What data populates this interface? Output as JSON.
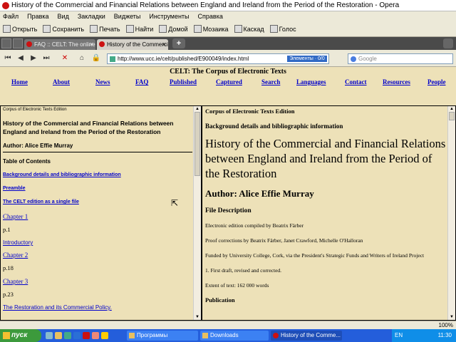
{
  "window": {
    "title": "History of the Commercial and Financial Relations between England and Ireland from the Period of the Restoration - Opera"
  },
  "menu": [
    "Файл",
    "Правка",
    "Вид",
    "Закладки",
    "Виджеты",
    "Инструменты",
    "Справка"
  ],
  "toolbar": [
    "Открыть",
    "Сохранить",
    "Печать",
    "Найти",
    "Домой",
    "Мозаика",
    "Каскад",
    "Голос"
  ],
  "tabs": [
    {
      "label": "FAQ :: CELT: The online..."
    },
    {
      "label": "History of the Commerci..."
    }
  ],
  "address": {
    "url": "http://www.ucc.ie/celt/published/E900049/index.html",
    "highlight": "Элементы · 0/0"
  },
  "search": {
    "placeholder": "Google"
  },
  "site": {
    "header": "CELT: The Corpus of Electronic Texts",
    "nav": [
      "Home",
      "About",
      "News",
      "FAQ",
      "Published",
      "Captured",
      "Search",
      "Languages",
      "Contact",
      "Resources",
      "People"
    ]
  },
  "left": {
    "edition": "Corpus of Electronic Texts Edition",
    "title": "History of the Commercial and Financial Relations between England and Ireland from the Period of the Restoration",
    "author": "Author: Alice Effie Murray",
    "toc": "Table of Contents",
    "links": [
      "Background details and bibliographic information",
      "Preamble",
      "The CELT edition as a single file"
    ],
    "chapters": [
      {
        "label": "Chapter 1",
        "page": "p.1"
      },
      {
        "label": "Introductory",
        "page": ""
      },
      {
        "label": "Chapter 2",
        "page": "p.18"
      },
      {
        "label": "Chapter 3",
        "page": "p.23"
      },
      {
        "label": "The Restoration and its Commercial Policy.",
        "page": ""
      }
    ]
  },
  "right": {
    "edition": "Corpus of Electronic Texts Edition",
    "background": "Background details and bibliographic information",
    "title": "History of the Commercial and Financial Relations between England and Ireland from the Period of the Restoration",
    "author": "Author: Alice Effie Murray",
    "file_description": "File Description",
    "lines": [
      "Electronic edition compiled by Beatrix Färber",
      "Proof corrections by Beatrix Färber, Janet Crawford, Michelle O'Halloran",
      "Funded by University College, Cork, via the President's Strategic Funds and Writers of Ireland Project",
      "1. First draft, revised and corrected.",
      "Extent of text: 162 000 words"
    ],
    "publication": "Publication"
  },
  "status": {
    "zoom": "100%"
  },
  "taskbar": {
    "start": "пуск",
    "buttons": [
      "Программы",
      "Downloads",
      "History of the Comme..."
    ],
    "lang": "EN",
    "clock": "11:30"
  }
}
